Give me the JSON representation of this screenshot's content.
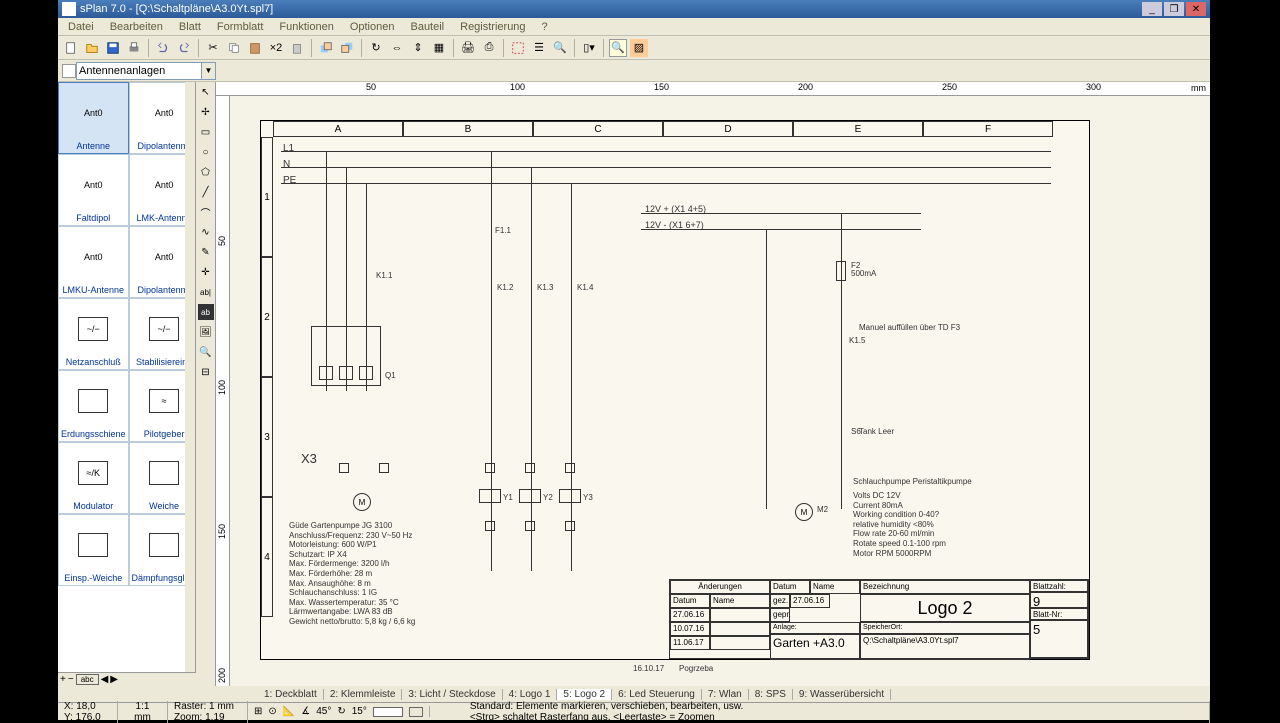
{
  "title": "sPlan 7.0 - [Q:\\Schaltpläne\\A3.0Yt.spl7]",
  "menu": [
    "Datei",
    "Bearbeiten",
    "Blatt",
    "Formblatt",
    "Funktionen",
    "Optionen",
    "Bauteil",
    "Registrierung",
    "?"
  ],
  "combo": "Antennenanlagen",
  "palette": [
    {
      "label": "Antenne",
      "sub": "Ant0",
      "sel": true
    },
    {
      "label": "Dipolantenne",
      "sub": "Ant0"
    },
    {
      "label": "Faltdipol",
      "sub": "Ant0"
    },
    {
      "label": "LMK-Antenne",
      "sub": "Ant0"
    },
    {
      "label": "LMKU-Antenne",
      "sub": "Ant0"
    },
    {
      "label": "Dipolantenne",
      "sub": "Ant0"
    },
    {
      "label": "Netzanschluß",
      "sub": "~/−"
    },
    {
      "label": "Stabilisiereinr.",
      "sub": "~/−"
    },
    {
      "label": "Erdungsschiene",
      "sub": ""
    },
    {
      "label": "Pilotgeber",
      "sub": "≈"
    },
    {
      "label": "Modulator",
      "sub": "≈/K"
    },
    {
      "label": "Weiche",
      "sub": ""
    },
    {
      "label": "Einsp.-Weiche",
      "sub": ""
    },
    {
      "label": "Dämpfungsglied",
      "sub": ""
    }
  ],
  "ruler_h": [
    "50",
    "100",
    "150",
    "200",
    "250",
    "300"
  ],
  "ruler_v": [
    "50",
    "100",
    "150",
    "200"
  ],
  "ruler_unit": "mm",
  "cols": [
    "A",
    "B",
    "C",
    "D",
    "E",
    "F"
  ],
  "rows": [
    "1",
    "2",
    "3",
    "4"
  ],
  "lines": {
    "l1": "L1",
    "n": "N",
    "pe": "PE"
  },
  "bus": {
    "p": "12V +   (X1 4+5)",
    "n": "12V -   (X1 6+7)"
  },
  "refs": {
    "k11": "K1.1",
    "k12": "K1.2",
    "k13": "K1.3",
    "k14": "K1.4",
    "k15": "K1.5",
    "f11": "F1.1",
    "f2": "F2",
    "f2a": "500mA",
    "q1": "Q1",
    "x3": "X3",
    "m1": "M",
    "m2": "M",
    "m2l": "M2",
    "y1": "Y1",
    "y2": "Y2",
    "y3": "Y3",
    "s6": "S6",
    "s6l": "Tank Leer",
    "note": "Manuel auffüllen über TD F3",
    "pump": "Schlauchpumpe Peristaltikpumpe"
  },
  "spec": [
    "Güde Gartenpumpe JG 3100",
    "Anschluss/Frequenz: 230 V~50 Hz",
    "Motorleistung: 600 W/P1",
    "Schutzart: IP X4",
    "Max. Fördermenge: 3200 l/h",
    "Max. Förderhöhe: 28 m",
    "Max. Ansaughöhe: 8 m",
    "Schlauchanschluss: 1 IG",
    "Max. Wassertemperatur: 35 °C",
    "Lärmwertangabe: LWA 83 dB",
    "Gewicht netto/brutto: 5,8 kg / 6,6 kg"
  ],
  "spec2": [
    "Volts DC 12V",
    "Current 80mA",
    "Working condition 0-40?",
    "relative humidity <80%",
    "Flow rate 20-60 ml/min",
    "Rotate speed 0.1-100 rpm",
    "Motor RPM 5000RPM"
  ],
  "tb": {
    "aenderungen": "Änderungen",
    "datum": "Datum",
    "name": "Name",
    "bezeichnung": "Bezeichnung",
    "blattzahl": "Blattzahl:",
    "blattnr": "Blatt-Nr:",
    "d1": "27.06.16",
    "d2": "10.07.16",
    "d3": "11.06.17",
    "gez": "gez.",
    "gepr": "gepr.",
    "gezd": "27.06.16",
    "anlage": "Anlage:",
    "anlagev": "Garten +A3.0",
    "logo": "Logo 2",
    "speicher": "SpeicherOrt:",
    "speicherv": "Q:\\Schaltpläne\\A3.0Yt.spl7",
    "bz": "9",
    "bn": "5",
    "footd": "16.10.17",
    "footn": "Pogrzeba"
  },
  "tabs": [
    "1: Deckblatt",
    "2: Klemmleiste",
    "3: Licht / Steckdose",
    "4: Logo 1",
    "5: Logo 2",
    "6: Led Steuerung",
    "7: Wlan",
    "8: SPS",
    "9: Wasserübersicht"
  ],
  "status": {
    "x": "X: 18,0",
    "y": "Y: 176,0",
    "scale": "1:1",
    "unit": "mm",
    "raster": "Raster: 1 mm",
    "zoom": "Zoom:  1,19",
    "a1": "45°",
    "a2": "15°",
    "hint": "Standard: Elemente markieren, verschieben, bearbeiten, usw.",
    "hint2": "<Strg> schaltet Rasterfang aus, <Leertaste> = Zoomen"
  }
}
